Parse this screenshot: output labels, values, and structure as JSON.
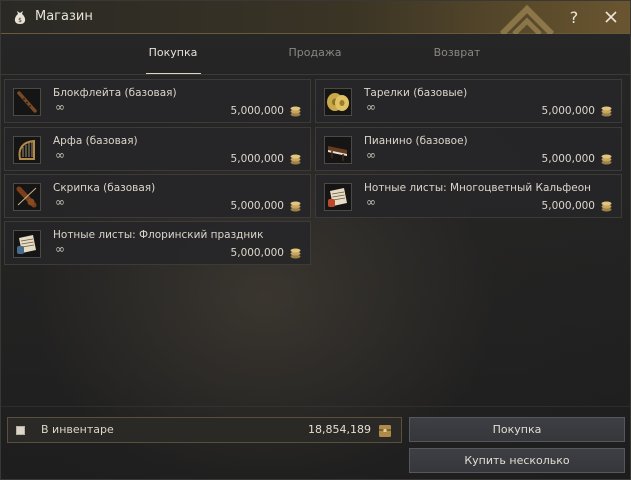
{
  "window": {
    "title": "Магазин",
    "help_label": "?"
  },
  "tabs": [
    {
      "label": "Покупка",
      "active": true
    },
    {
      "label": "Продажа",
      "active": false
    },
    {
      "label": "Возврат",
      "active": false
    }
  ],
  "items": [
    {
      "name": "Блокфлейта (базовая)",
      "qty": "∞",
      "price": "5,000,000",
      "icon": "recorder-icon"
    },
    {
      "name": "Тарелки (базовые)",
      "qty": "∞",
      "price": "5,000,000",
      "icon": "cymbals-icon"
    },
    {
      "name": "Арфа (базовая)",
      "qty": "∞",
      "price": "5,000,000",
      "icon": "harp-icon"
    },
    {
      "name": "Пианино (базовое)",
      "qty": "∞",
      "price": "5,000,000",
      "icon": "piano-icon"
    },
    {
      "name": "Скрипка (базовая)",
      "qty": "∞",
      "price": "5,000,000",
      "icon": "violin-icon"
    },
    {
      "name": "Нотные листы: Многоцветный Кальфеон",
      "qty": "∞",
      "price": "5,000,000",
      "icon": "sheet-music-icon"
    },
    {
      "name": "Нотные листы: Флоринский праздник",
      "qty": "∞",
      "price": "5,000,000",
      "icon": "sheet-music-icon"
    }
  ],
  "inventory": {
    "label": "В инвентаре",
    "value": "18,854,189"
  },
  "buttons": {
    "buy": "Покупка",
    "buy_multiple": "Купить несколько"
  },
  "colors": {
    "accent_gold": "#c9a86a",
    "title_bar_gold": "#6a5530"
  }
}
